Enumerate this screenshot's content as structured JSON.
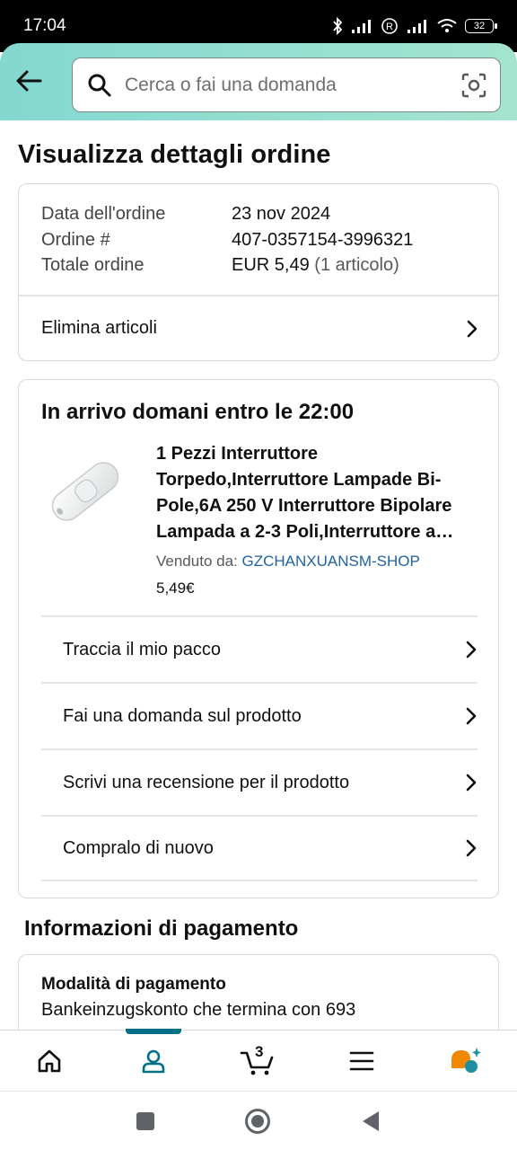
{
  "status_bar": {
    "time": "17:04",
    "battery": "32"
  },
  "search": {
    "placeholder": "Cerca o fai una domanda"
  },
  "page_title": "Visualizza dettagli ordine",
  "order": {
    "date_label": "Data dell'ordine",
    "date_value": "23 nov 2024",
    "number_label": "Ordine #",
    "number_value": "407-0357154-3996321",
    "total_label": "Totale ordine",
    "total_value": "EUR 5,49",
    "total_items": "(1 articolo)",
    "delete_label": "Elimina articoli"
  },
  "shipment": {
    "status": "In arrivo domani entro le 22:00",
    "product_title": "1 Pezzi Interruttore Torpedo,Interruttore Lampade Bi-Pole,6A 250 V Interruttore Bipolare Lampada a 2-3 Poli,Interruttore a…",
    "seller_label": "Venduto da:",
    "seller_name": "GZCHANXUANSM-SHOP",
    "price": "5,49€",
    "actions": [
      {
        "label": "Traccia il mio pacco"
      },
      {
        "label": "Fai una domanda sul prodotto"
      },
      {
        "label": "Scrivi una recensione per il prodotto"
      },
      {
        "label": "Compralo di nuovo"
      }
    ]
  },
  "payment": {
    "section_title": "Informazioni di pagamento",
    "method_label": "Modalità di pagamento",
    "method_value": "Bankeinzugskonto che termina con 693"
  },
  "bottom_nav": {
    "cart_count": "3",
    "active": "account"
  },
  "colors": {
    "header_start": "#83d8d0",
    "header_end": "#a4e4cf",
    "link": "#2162a1",
    "active": "#007185",
    "rufus": "#f08804"
  }
}
